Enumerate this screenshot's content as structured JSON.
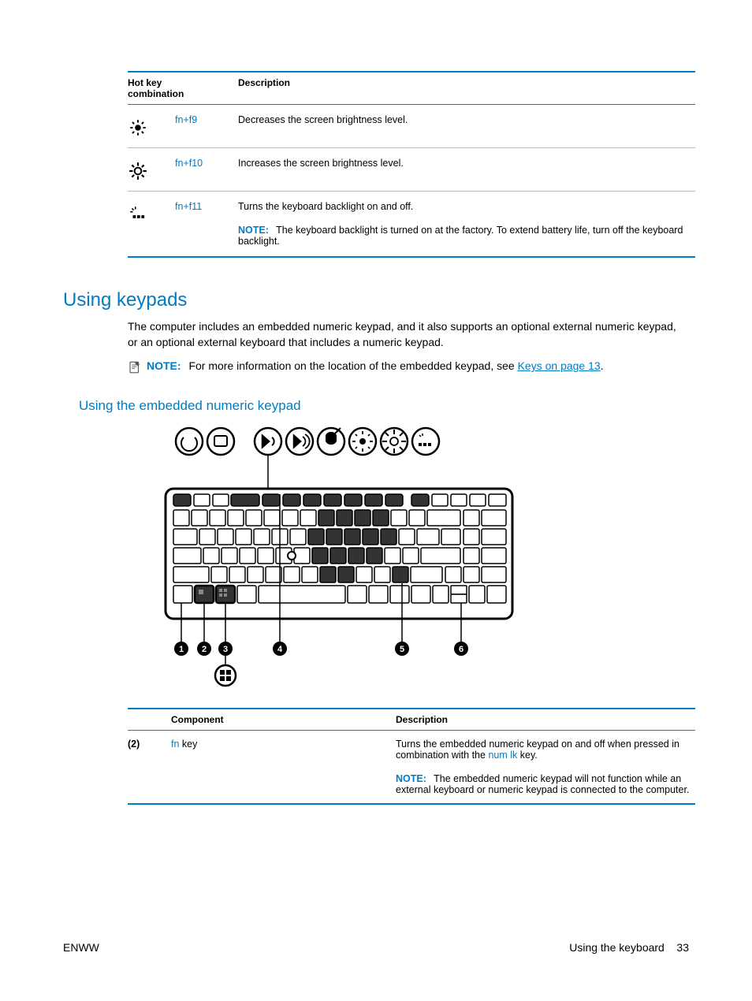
{
  "hotkey_table": {
    "headers": {
      "combo": "Hot key combination",
      "desc": "Description"
    },
    "rows": [
      {
        "combo_fn": "fn",
        "combo_plus": "+",
        "combo_key": "f9",
        "desc": "Decreases the screen brightness level."
      },
      {
        "combo_fn": "fn",
        "combo_plus": "+",
        "combo_key": "f10",
        "desc": "Increases the screen brightness level."
      },
      {
        "combo_fn": "fn",
        "combo_plus": "+",
        "combo_key": "f11",
        "desc": "Turns the keyboard backlight on and off.",
        "note_label": "NOTE:",
        "note_text": "The keyboard backlight is turned on at the factory. To extend battery life, turn off the keyboard backlight."
      }
    ]
  },
  "section_heading": "Using keypads",
  "intro_paragraph": "The computer includes an embedded numeric keypad, and it also supports an optional external numeric keypad, or an optional external keyboard that includes a numeric keypad.",
  "page_note": {
    "label": "NOTE:",
    "pre": "For more information on the location of the embedded keypad, see ",
    "link": "Keys on page 13",
    "post": "."
  },
  "sub_heading": "Using the embedded numeric keypad",
  "component_table": {
    "headers": {
      "component": "Component",
      "desc": "Description"
    },
    "row": {
      "num": "(2)",
      "name_fn": "fn",
      "name_rest": " key",
      "desc_pre": "Turns the embedded numeric keypad on and off when pressed in combination with the ",
      "desc_link": "num lk",
      "desc_post": " key.",
      "note_label": "NOTE:",
      "note_text": "The embedded numeric keypad will not function while an external keyboard or numeric keypad is connected to the computer."
    }
  },
  "footer": {
    "left": "ENWW",
    "right_label": "Using the keyboard",
    "page_num": "33"
  }
}
